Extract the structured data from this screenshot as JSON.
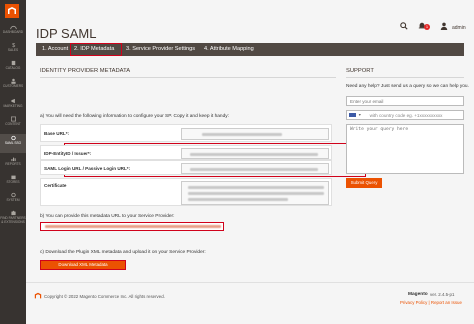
{
  "sidebar": {
    "items": [
      {
        "label": "DASHBOARD",
        "icon": "dashboard-icon"
      },
      {
        "label": "SALES",
        "icon": "dollar-icon"
      },
      {
        "label": "CATALOG",
        "icon": "cube-icon"
      },
      {
        "label": "CUSTOMERS",
        "icon": "users-icon"
      },
      {
        "label": "MARKETING",
        "icon": "megaphone-icon"
      },
      {
        "label": "CONTENT",
        "icon": "layout-icon"
      },
      {
        "label": "SAML SSO",
        "icon": "gear-icon"
      },
      {
        "label": "REPORTS",
        "icon": "chart-icon"
      },
      {
        "label": "STORES",
        "icon": "store-icon"
      },
      {
        "label": "SYSTEM",
        "icon": "gear-icon"
      },
      {
        "label": "FIND PARTNERS & EXTENSIONS",
        "icon": "puzzle-icon"
      }
    ]
  },
  "header": {
    "title": "IDP SAML",
    "notification_count": "1",
    "user": "admin"
  },
  "tabs": [
    {
      "label": "1. Account",
      "active": false
    },
    {
      "label": "2. IDP Metadata",
      "active": true
    },
    {
      "label": "3. Service Provider Settings",
      "active": false
    },
    {
      "label": "4. Attribute Mapping",
      "active": false
    }
  ],
  "main": {
    "section_title": "IDENTITY PROVIDER METADATA",
    "intro_a": "a) You will need the following information to configure your SP. Copy it and keep it handy:",
    "fields": [
      {
        "label": "Base URL*:"
      },
      {
        "label": "IDP-EntityID / Issuer*:"
      },
      {
        "label": "SAML Login URL / Passive Login URL*:"
      },
      {
        "label": "Certificate"
      }
    ],
    "intro_b": "b) You can provide this metadata URL to your Service Provider:",
    "intro_c": "c) Download the Plugin XML metadata and upload it on your Service Provider:",
    "download_button": "Download XML Metadata"
  },
  "support": {
    "title": "SUPPORT",
    "question": "Need any help? Just send us a query so we can help you.",
    "email_placeholder": "Enter your email",
    "phone_placeholder": "with country code eg. +1xxxxxxxxxx",
    "query_placeholder": "Write your query here",
    "submit_button": "Submit Query"
  },
  "footer": {
    "copyright": "Copyright © 2022 Magento Commerce Inc. All rights reserved.",
    "brand": "Magento",
    "version": "ver. 2.4.5-p1",
    "report_link": "Privacy Policy | Report an Issue"
  },
  "colors": {
    "accent": "#eb5202",
    "highlight": "#d0021b",
    "sidebar": "#373330",
    "tabbar": "#514943"
  }
}
